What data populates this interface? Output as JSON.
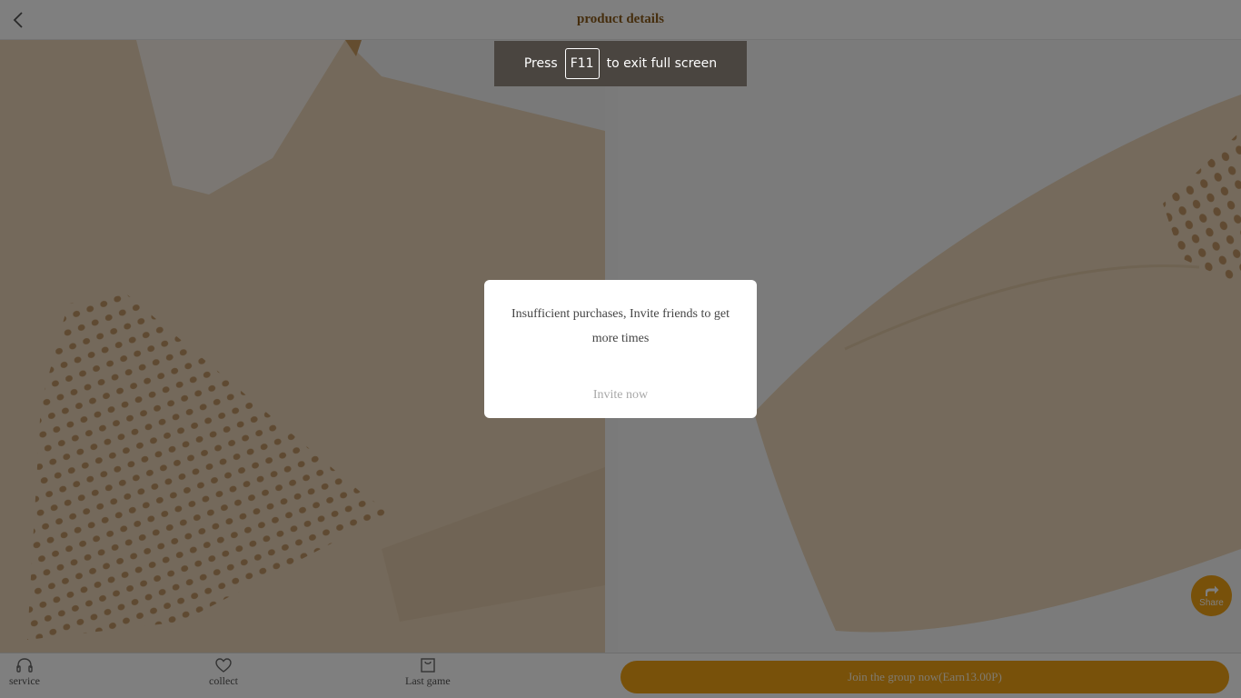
{
  "header": {
    "title": "product details",
    "back_icon": "chevron-left-icon"
  },
  "fullscreen_notice": {
    "prefix": "Press",
    "key": "F11",
    "suffix": "to exit full screen"
  },
  "dialog": {
    "message": "Insufficient purchases, Invite friends to get more times",
    "button_label": "Invite now"
  },
  "share": {
    "label": "Share",
    "icon": "share-icon"
  },
  "bottom_bar": {
    "tabs": [
      {
        "label": "service",
        "icon": "headset-icon"
      },
      {
        "label": "collect",
        "icon": "heart-icon"
      },
      {
        "label": "Last game",
        "icon": "shopping-bag-icon"
      }
    ],
    "join_button": "Join the group now(Earn13.00P)"
  },
  "colors": {
    "accent": "#f0a215",
    "title": "#8a5b1a",
    "product": "#e8d2b4"
  }
}
